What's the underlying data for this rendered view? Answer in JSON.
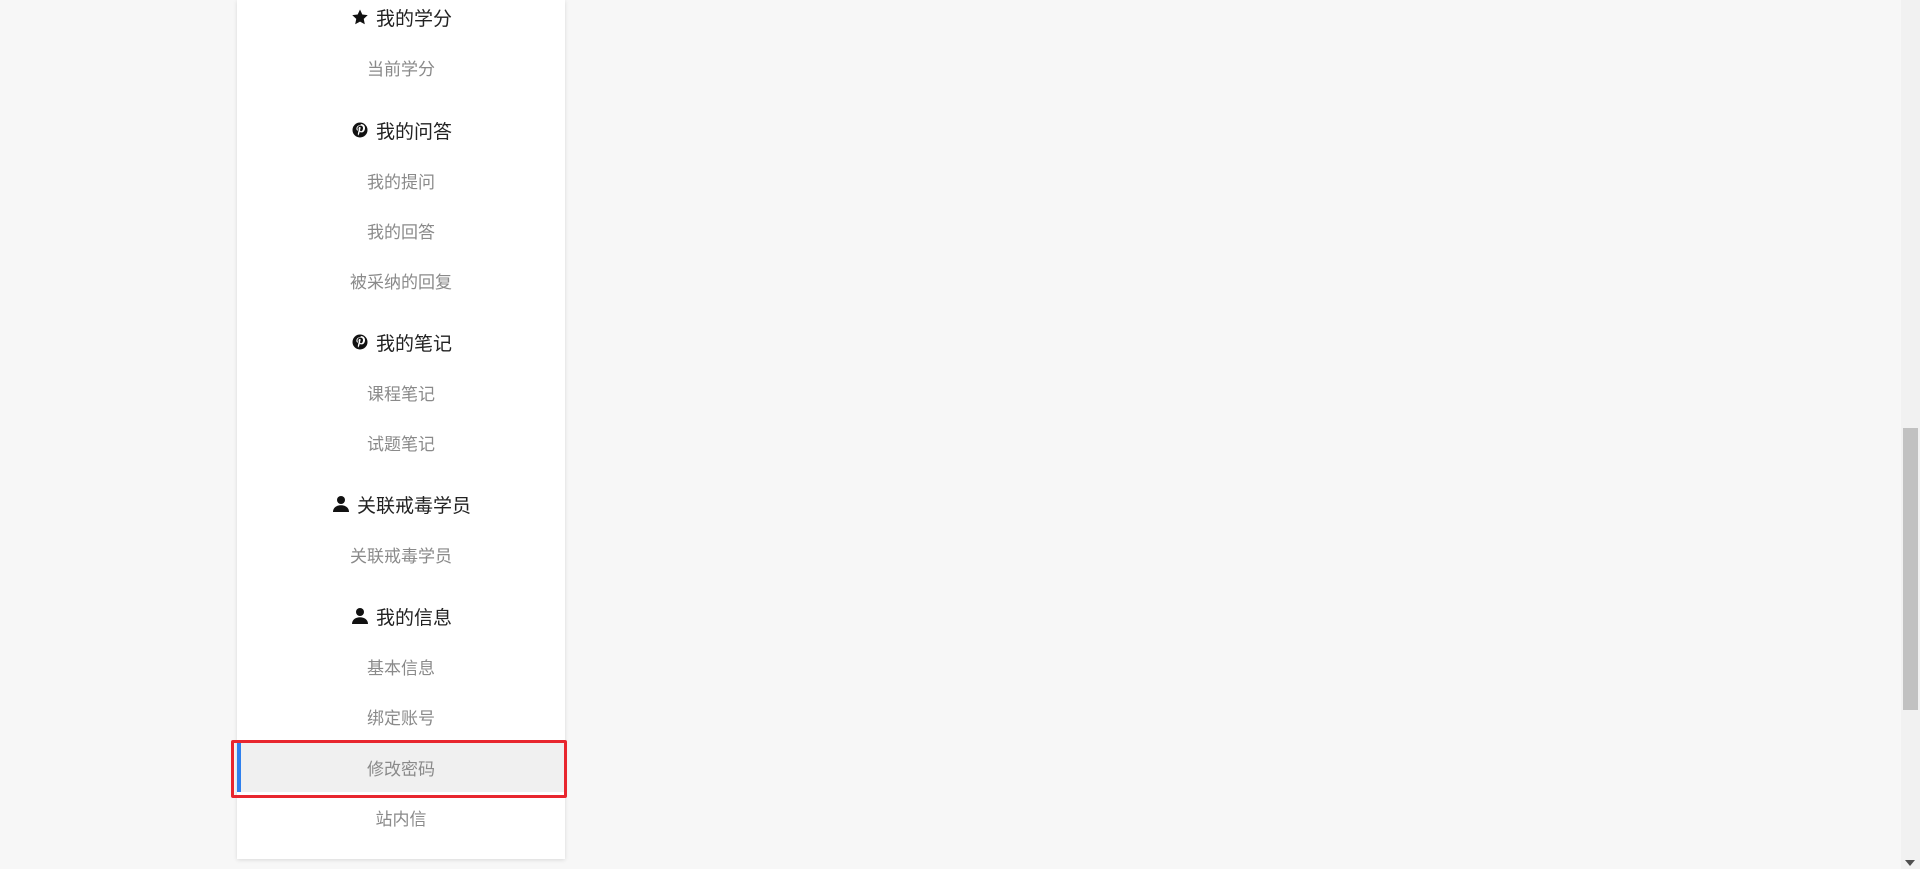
{
  "sidebar": {
    "groups": [
      {
        "title": "我的学分",
        "icon": "star-icon",
        "items": [
          "当前学分"
        ]
      },
      {
        "title": "我的问答",
        "icon": "pinterest-icon",
        "items": [
          "我的提问",
          "我的回答",
          "被采纳的回复"
        ]
      },
      {
        "title": "我的笔记",
        "icon": "pinterest-icon",
        "items": [
          "课程笔记",
          "试题笔记"
        ]
      },
      {
        "title": "关联戒毒学员",
        "icon": "user-icon",
        "items": [
          "关联戒毒学员"
        ]
      },
      {
        "title": "我的信息",
        "icon": "user-icon",
        "items": [
          "基本信息",
          "绑定账号",
          "修改密码",
          "站内信"
        ]
      }
    ],
    "active_item": "修改密码"
  },
  "colors": {
    "active_indicator": "#2f80ed",
    "highlight_border": "#e8262e",
    "item_text": "#8a8a8a",
    "header_text": "#222222"
  }
}
